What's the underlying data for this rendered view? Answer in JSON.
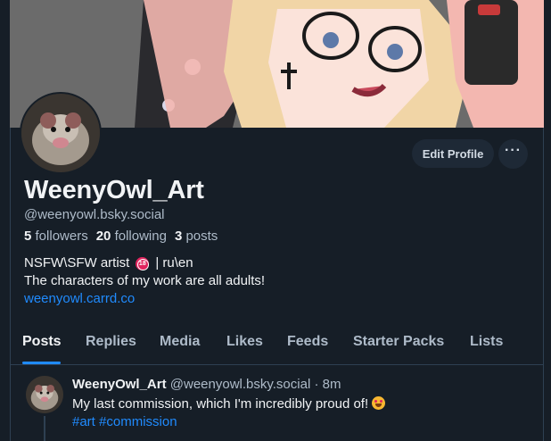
{
  "profile": {
    "display_name": "WeenyOwl_Art",
    "handle": "@weenyowl.bsky.social",
    "followers_count": "5",
    "followers_label": "followers",
    "following_count": "20",
    "following_label": "following",
    "posts_count": "3",
    "posts_label": "posts",
    "bio_line1_a": "NSFW\\SFW artist",
    "bio_line1_b": "| ru\\en",
    "bio_badge": "18",
    "bio_line2": "The characters of my work are all adults!",
    "bio_link": "weenyowl.carrd.co"
  },
  "actions": {
    "edit_profile": "Edit Profile",
    "more": "···"
  },
  "tabs": [
    "Posts",
    "Replies",
    "Media",
    "Likes",
    "Feeds",
    "Starter Packs",
    "Lists"
  ],
  "active_tab": "Posts",
  "post": {
    "author_name": "WeenyOwl_Art",
    "author_handle": "@weenyowl.bsky.social",
    "separator": " · ",
    "time": "8m",
    "text": "My last commission, which I'm incredibly proud of!",
    "emoji": "star-struck-face-icon",
    "tags": "#art #commission"
  },
  "colors": {
    "background": "#161e27",
    "accent": "#208bfe",
    "secondary_text": "#aebbc9",
    "button_bg": "#1e2936"
  }
}
